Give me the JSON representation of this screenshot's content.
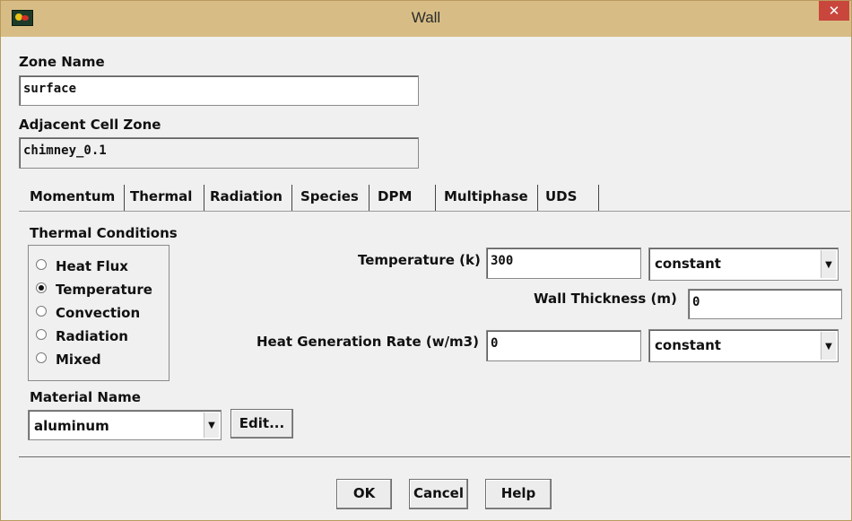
{
  "window": {
    "title": "Wall",
    "close_glyph": "✕"
  },
  "zone": {
    "name_label": "Zone Name",
    "name_value": "surface",
    "adjacent_label": "Adjacent Cell Zone",
    "adjacent_value": "chimney_0.1"
  },
  "tabs": [
    "Momentum",
    "Thermal",
    "Radiation",
    "Species",
    "DPM",
    "Multiphase",
    "UDS"
  ],
  "active_tab": "Thermal",
  "thermal": {
    "conditions_label": "Thermal Conditions",
    "options": [
      "Heat Flux",
      "Temperature",
      "Convection",
      "Radiation",
      "Mixed"
    ],
    "selected": "Temperature",
    "temperature_label": "Temperature (k)",
    "temperature_value": "300",
    "temperature_method": "constant",
    "wall_thickness_label": "Wall Thickness (m)",
    "wall_thickness_value": "0",
    "heat_gen_label": "Heat Generation Rate (w/m3)",
    "heat_gen_value": "0",
    "heat_gen_method": "constant",
    "material_label": "Material Name",
    "material_value": "aluminum",
    "edit_label": "Edit..."
  },
  "buttons": {
    "ok": "OK",
    "cancel": "Cancel",
    "help": "Help"
  },
  "icons": {
    "dropdown": "chevron-down-icon",
    "app": "fluent-app-icon"
  },
  "colors": {
    "titlebar": "#d7bd85",
    "close": "#c9463d",
    "dialog_bg": "#f0f0f0"
  }
}
